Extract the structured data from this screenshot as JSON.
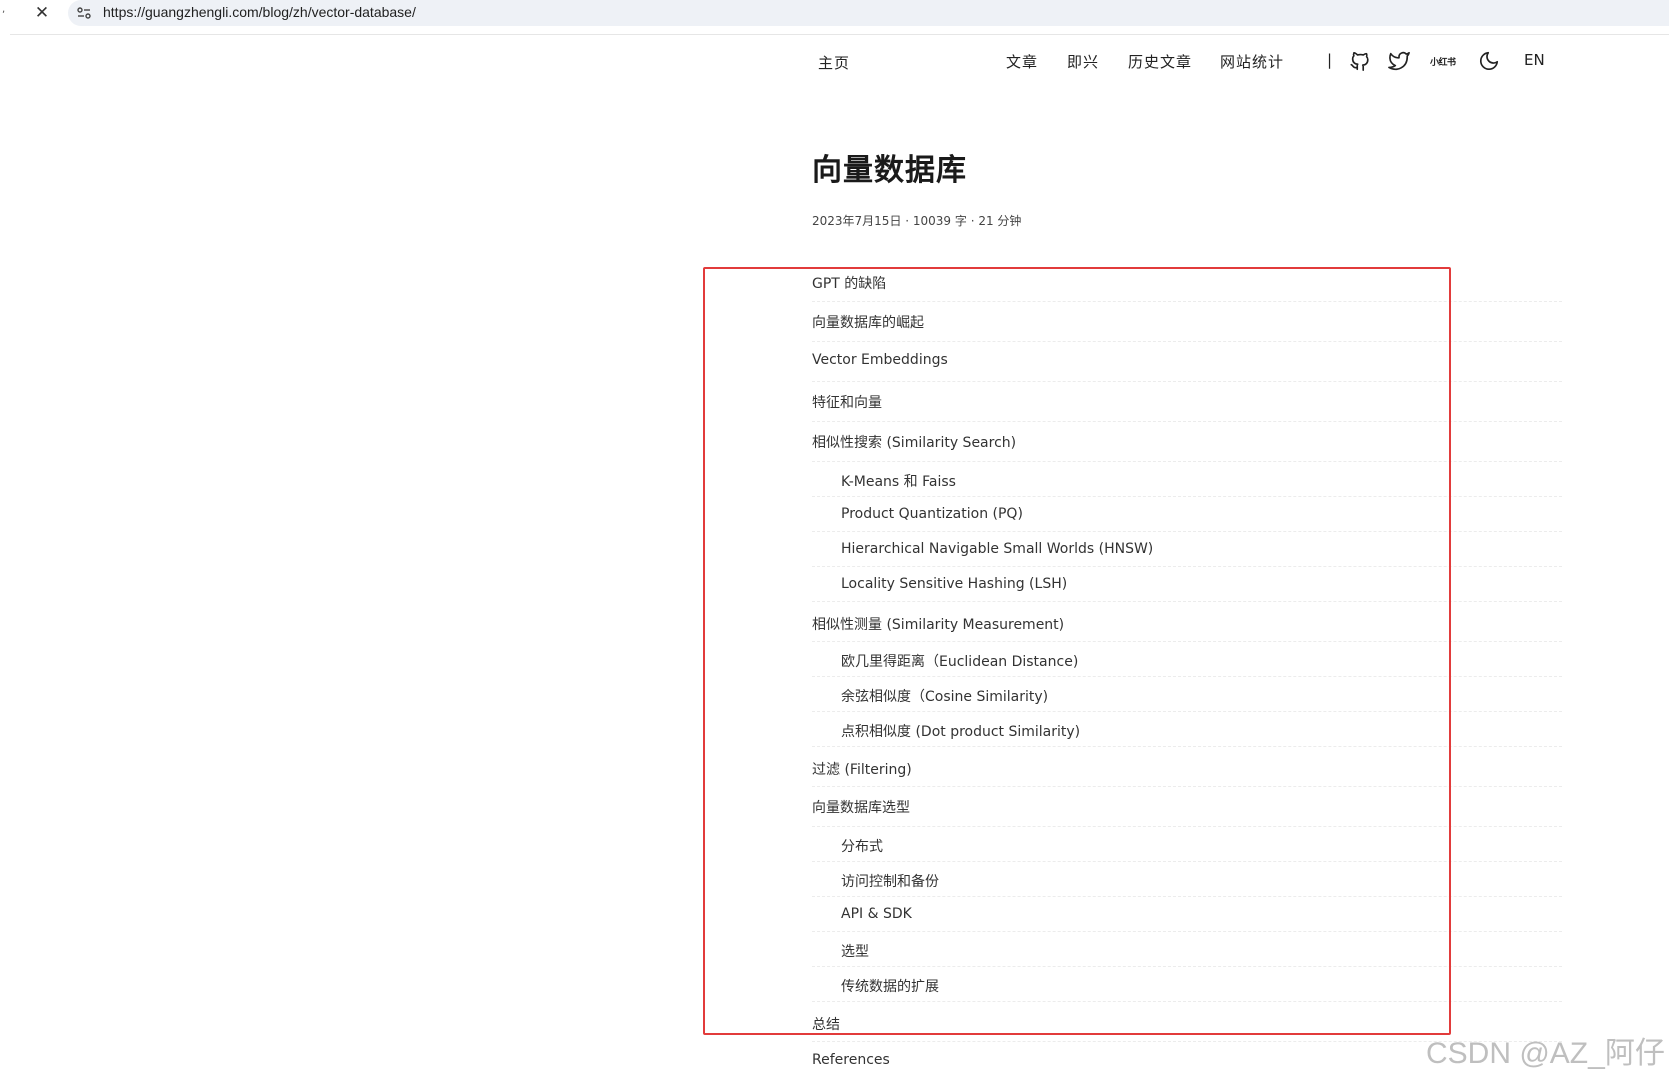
{
  "browser": {
    "url": "https://guangzhengli.com/blog/zh/vector-database/",
    "close_glyph": "✕"
  },
  "nav": {
    "home": "主页",
    "links": [
      "文章",
      "即兴",
      "历史文章",
      "网站统计"
    ],
    "separator": "|",
    "xhs": "小红书",
    "lang": "EN"
  },
  "article": {
    "title": "向量数据库",
    "meta": "2023年7月15日 · 10039 字 · 21 分钟"
  },
  "toc": [
    {
      "level": 1,
      "text": "GPT 的缺陷"
    },
    {
      "level": 1,
      "text": "向量数据库的崛起"
    },
    {
      "level": 1,
      "text": "Vector Embeddings"
    },
    {
      "level": 1,
      "text": "特征和向量"
    },
    {
      "level": 1,
      "text": "相似性搜索 (Similarity Search)"
    },
    {
      "level": 2,
      "text": "K-Means 和 Faiss"
    },
    {
      "level": 2,
      "text": "Product Quantization (PQ)"
    },
    {
      "level": 2,
      "text": "Hierarchical Navigable Small Worlds (HNSW)"
    },
    {
      "level": 2,
      "text": "Locality Sensitive Hashing (LSH)"
    },
    {
      "level": 1,
      "text": "相似性测量 (Similarity Measurement)"
    },
    {
      "level": 2,
      "text": "欧几里得距离（Euclidean Distance)"
    },
    {
      "level": 2,
      "text": "余弦相似度（Cosine Similarity)"
    },
    {
      "level": 2,
      "text": "点积相似度 (Dot product Similarity)"
    },
    {
      "level": 1,
      "text": "过滤 (Filtering)"
    },
    {
      "level": 1,
      "text": "向量数据库选型"
    },
    {
      "level": 2,
      "text": "分布式"
    },
    {
      "level": 2,
      "text": "访问控制和备份"
    },
    {
      "level": 2,
      "text": "API & SDK"
    },
    {
      "level": 2,
      "text": "选型"
    },
    {
      "level": 2,
      "text": "传统数据的扩展"
    },
    {
      "level": 1,
      "text": "总结"
    },
    {
      "level": 1,
      "text": "References"
    }
  ],
  "watermark": "CSDN @AZ_阿仔",
  "colors": {
    "highlight": "#e23b3b",
    "url_bar": "#eef1f6"
  }
}
